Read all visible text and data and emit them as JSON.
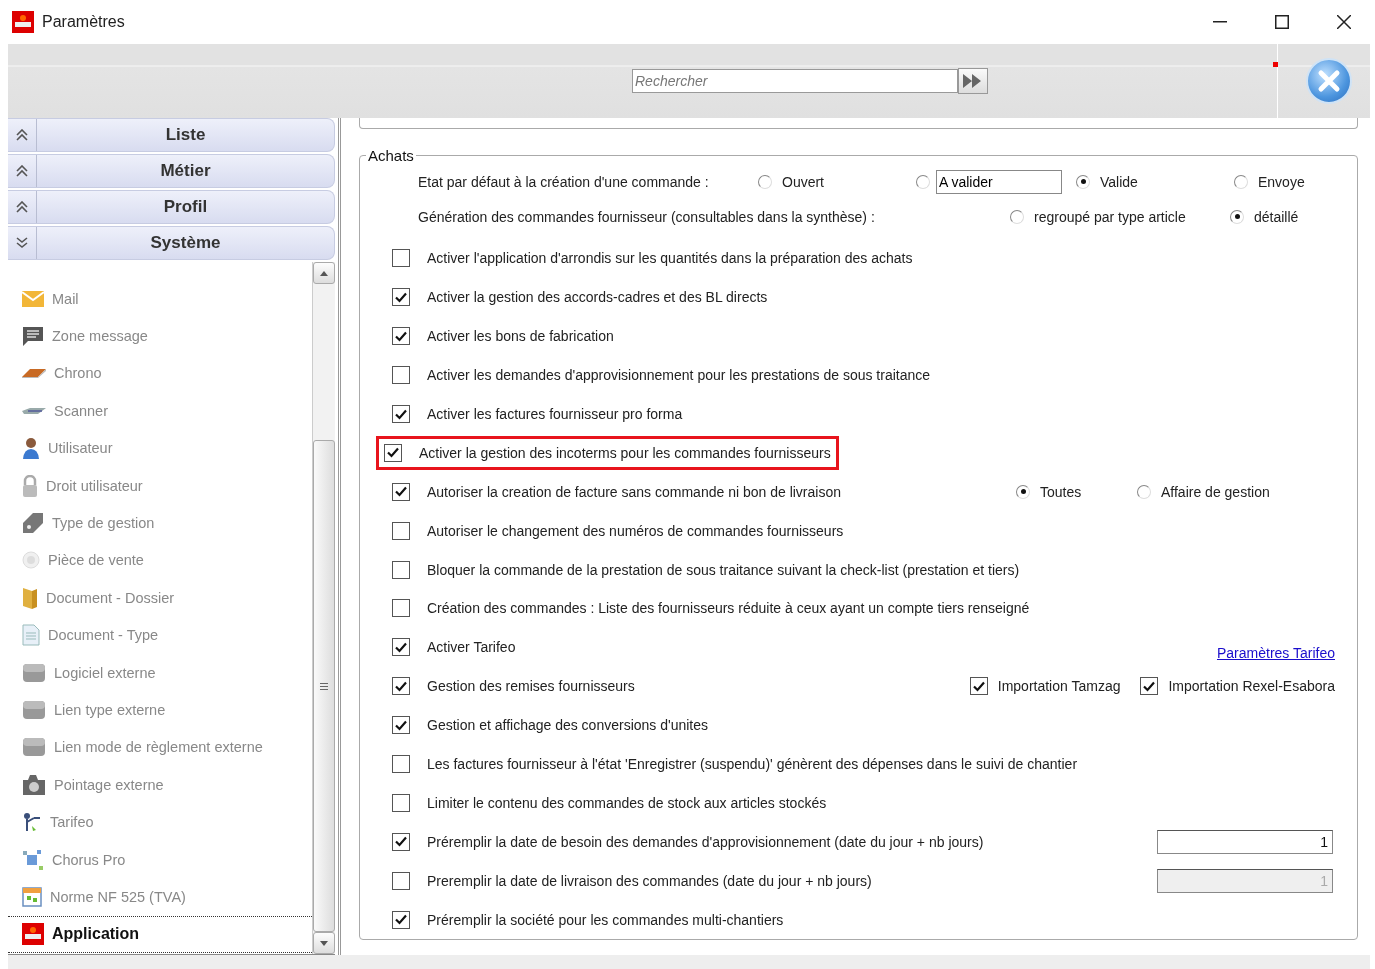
{
  "window": {
    "title": "Paramètres"
  },
  "search": {
    "placeholder": "Rechercher"
  },
  "sidebar": {
    "groups": [
      {
        "label": "Liste",
        "expanded": false
      },
      {
        "label": "Métier",
        "expanded": false
      },
      {
        "label": "Profil",
        "expanded": false
      },
      {
        "label": "Système",
        "expanded": true
      }
    ],
    "items": [
      {
        "label": "Mail",
        "selected": false
      },
      {
        "label": "Zone message",
        "selected": false
      },
      {
        "label": "Chrono",
        "selected": false
      },
      {
        "label": "Scanner",
        "selected": false
      },
      {
        "label": "Utilisateur",
        "selected": false
      },
      {
        "label": "Droit utilisateur",
        "selected": false
      },
      {
        "label": "Type de gestion",
        "selected": false
      },
      {
        "label": "Pièce de vente",
        "selected": false
      },
      {
        "label": "Document - Dossier",
        "selected": false
      },
      {
        "label": "Document - Type",
        "selected": false
      },
      {
        "label": "Logiciel externe",
        "selected": false
      },
      {
        "label": "Lien type externe",
        "selected": false
      },
      {
        "label": "Lien mode de règlement externe",
        "selected": false
      },
      {
        "label": "Pointage externe",
        "selected": false
      },
      {
        "label": "Tarifeo",
        "selected": false
      },
      {
        "label": "Chorus Pro",
        "selected": false
      },
      {
        "label": "Norme NF 525 (TVA)",
        "selected": false
      },
      {
        "label": "Application",
        "selected": true
      }
    ]
  },
  "achats": {
    "title": "Achats",
    "option_rows": [
      {
        "label": "Etat par défaut à la création d'une commande :",
        "options": [
          {
            "kind": "radio",
            "label": "Ouvert",
            "selected": false
          },
          {
            "kind": "radio_field",
            "value": "A valider",
            "selected": false
          },
          {
            "kind": "radio",
            "label": "Valide",
            "selected": true
          },
          {
            "kind": "radio",
            "label": "Envoye",
            "selected": false
          }
        ]
      },
      {
        "label": "Génération des commandes fournisseur (consultables dans la synthèse) :",
        "options": [
          {
            "kind": "radio",
            "label": "regroupé par type article",
            "selected": false
          },
          {
            "kind": "radio",
            "label": "détaillé",
            "selected": true
          }
        ]
      }
    ],
    "rows": [
      {
        "label": "Activer l'application d'arrondis sur les quantités dans la préparation des achats",
        "checked": false,
        "highlighted": false
      },
      {
        "label": "Activer la gestion des accords-cadres et des BL directs",
        "checked": true,
        "highlighted": false
      },
      {
        "label": "Activer les bons de fabrication",
        "checked": true,
        "highlighted": false
      },
      {
        "label": "Activer les demandes d'approvisionnement pour les prestations de sous traitance",
        "checked": false,
        "highlighted": false
      },
      {
        "label": "Activer les factures fournisseur pro forma",
        "checked": true,
        "highlighted": false
      },
      {
        "label": "Activer la gestion des incoterms pour les commandes fournisseurs",
        "checked": true,
        "highlighted": true
      },
      {
        "label": "Autoriser la creation de facture sans commande ni bon de livraison",
        "checked": true,
        "highlighted": false,
        "extra": {
          "kind": "radios",
          "items": [
            {
              "label": "Toutes",
              "selected": true
            },
            {
              "label": "Affaire de gestion",
              "selected": false
            }
          ]
        }
      },
      {
        "label": "Autoriser le changement des numéros de commandes fournisseurs",
        "checked": false,
        "highlighted": false
      },
      {
        "label": "Bloquer la commande de la prestation de sous traitance suivant la check-list (prestation et tiers)",
        "checked": false,
        "highlighted": false
      },
      {
        "label": "Création des commandes : Liste des fournisseurs réduite à ceux ayant un compte tiers renseigné",
        "checked": false,
        "highlighted": false
      },
      {
        "label": "Activer Tarifeo",
        "checked": true,
        "highlighted": false,
        "extra": {
          "kind": "link",
          "label": "Paramètres Tarifeo"
        }
      },
      {
        "label": "Gestion des remises fournisseurs",
        "checked": true,
        "highlighted": false,
        "extra": {
          "kind": "checkboxes",
          "items": [
            {
              "label": "Importation Tamzag",
              "checked": true
            },
            {
              "label": "Importation Rexel-Esabora",
              "checked": true
            }
          ]
        }
      },
      {
        "label": "Gestion et affichage des conversions d'unites",
        "checked": true,
        "highlighted": false
      },
      {
        "label": "Les factures fournisseur à l'état 'Enregistrer (suspendu)' génèrent des dépenses dans le suivi de chantier",
        "checked": false,
        "highlighted": false
      },
      {
        "label": "Limiter le contenu des commandes de stock aux articles stockés",
        "checked": false,
        "highlighted": false
      },
      {
        "label": "Préremplir la date de besoin des demandes d'approvisionnement (date du jour + nb jours)",
        "checked": true,
        "highlighted": false,
        "extra": {
          "kind": "number_field",
          "value": "1",
          "disabled": false
        }
      },
      {
        "label": "Preremplir la date de livraison des commandes (date du jour + nb jours)",
        "checked": false,
        "highlighted": false,
        "extra": {
          "kind": "number_field",
          "value": "1",
          "disabled": true
        }
      },
      {
        "label": "Préremplir la société pour les commandes multi-chantiers",
        "checked": true,
        "highlighted": false
      }
    ]
  }
}
